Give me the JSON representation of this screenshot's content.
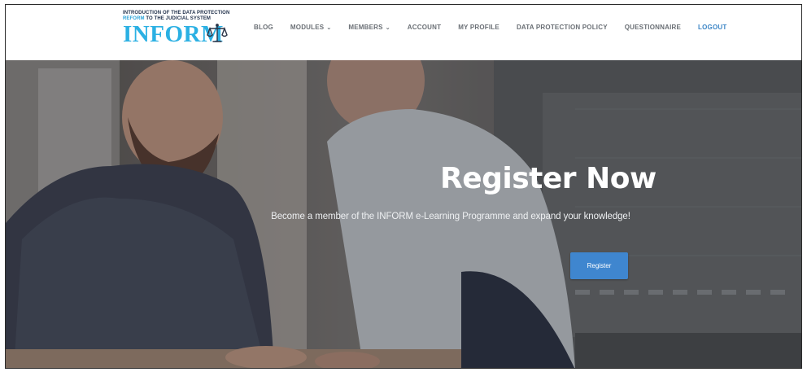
{
  "logo": {
    "tagline_line1": "INTRODUCTION OF THE DATA PROTECTION",
    "tagline_line2_accent": "REFORM",
    "tagline_line2_rest": " TO THE JUDICIAL SYSTEM",
    "wordmark": "INFORM",
    "icon": "scales-of-justice-icon"
  },
  "nav": {
    "items": [
      {
        "label": "BLOG",
        "dropdown": false,
        "active": false
      },
      {
        "label": "MODULES",
        "dropdown": true,
        "active": false
      },
      {
        "label": "MEMBERS",
        "dropdown": true,
        "active": false
      },
      {
        "label": "ACCOUNT",
        "dropdown": false,
        "active": false
      },
      {
        "label": "MY PROFILE",
        "dropdown": false,
        "active": false
      },
      {
        "label": "DATA PROTECTION POLICY",
        "dropdown": false,
        "active": false
      },
      {
        "label": "QUESTIONNAIRE",
        "dropdown": false,
        "active": false
      },
      {
        "label": "LOGOUT",
        "dropdown": false,
        "active": true
      }
    ],
    "caret_glyph": "⌄"
  },
  "hero": {
    "title": "Register Now",
    "subtitle": "Become a member of the INFORM e-Learning Programme and expand your knowledge!",
    "button_label": "Register",
    "image_description": "photo of two men in checked shirts working at a desk"
  },
  "colors": {
    "brand": "#2bb0e3",
    "nav_text": "#6a6f75",
    "nav_active": "#3d86c6",
    "button": "#3f86cf"
  }
}
